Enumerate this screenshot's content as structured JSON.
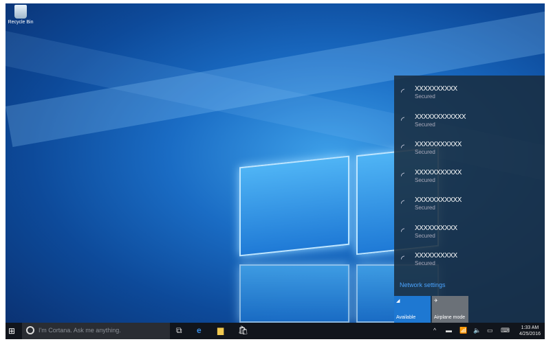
{
  "desktop": {
    "recycle_bin": "Recycle Bin"
  },
  "network_flyout": {
    "networks": [
      {
        "ssid": "XXXXXXXXXX",
        "status": "Secured"
      },
      {
        "ssid": "XXXXXXXXXXXX",
        "status": "Secured"
      },
      {
        "ssid": "XXXXXXXXXXX",
        "status": "Secured"
      },
      {
        "ssid": "XXXXXXXXXXX",
        "status": "Secured"
      },
      {
        "ssid": "XXXXXXXXXXX",
        "status": "Secured"
      },
      {
        "ssid": "XXXXXXXXXX",
        "status": "Secured"
      },
      {
        "ssid": "XXXXXXXXXX",
        "status": "Secured"
      }
    ],
    "settings_link": "Network settings",
    "tiles": [
      {
        "label": "Available",
        "color": "#1e78d2"
      },
      {
        "label": "Airplane mode",
        "color": "#6b7178"
      }
    ]
  },
  "taskbar": {
    "search_placeholder": "I'm Cortana. Ask me anything.",
    "time": "1:33 AM",
    "date": "4/25/2016"
  }
}
